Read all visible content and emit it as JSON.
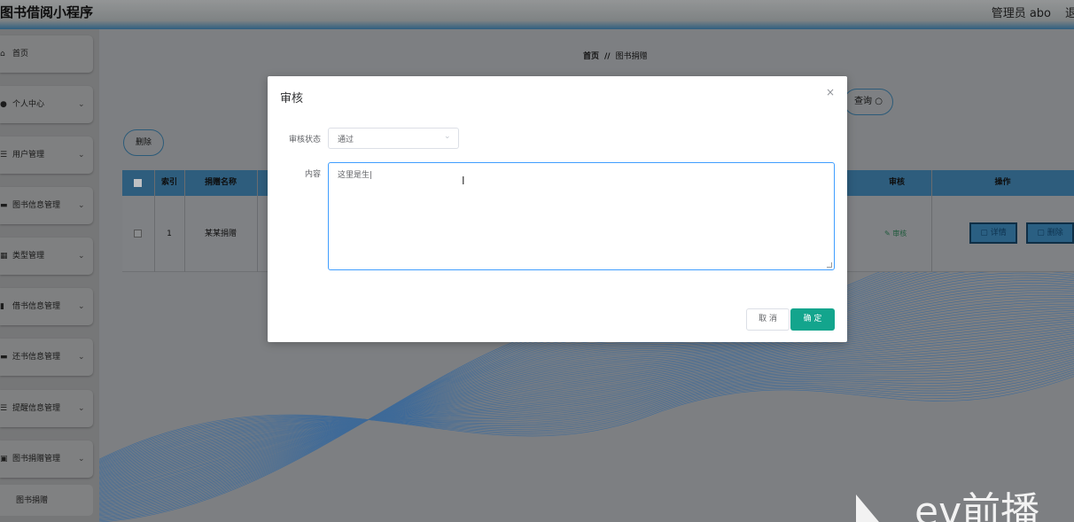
{
  "header": {
    "app_title": "图书借阅小程序",
    "admin_label": "管理员 abo",
    "logout_label": "退"
  },
  "sidebar": {
    "items": [
      {
        "label": "首页",
        "icon": "home-icon",
        "has_chevron": false
      },
      {
        "label": "个人中心",
        "icon": "user-icon",
        "has_chevron": true
      },
      {
        "label": "用户管理",
        "icon": "list-icon",
        "has_chevron": true
      },
      {
        "label": "图书信息管理",
        "icon": "card-icon",
        "has_chevron": true
      },
      {
        "label": "类型管理",
        "icon": "grid-icon",
        "has_chevron": true
      },
      {
        "label": "借书信息管理",
        "icon": "bar-chart-icon",
        "has_chevron": true
      },
      {
        "label": "还书信息管理",
        "icon": "card-icon",
        "has_chevron": true
      },
      {
        "label": "提醒信息管理",
        "icon": "list-icon",
        "has_chevron": true
      },
      {
        "label": "图书捐赠管理",
        "icon": "clipboard-icon",
        "has_chevron": true
      }
    ],
    "sub_item": {
      "label": "图书捐赠"
    }
  },
  "breadcrumb": {
    "home": "首页",
    "separator": "//",
    "current": "图书捐赠"
  },
  "toolbar": {
    "query_label": "查询",
    "delete_label": "删除"
  },
  "table": {
    "columns": {
      "index": "索引",
      "donation_name": "捐赠名称",
      "review": "审核",
      "actions": "操作"
    },
    "rows": [
      {
        "index": "1",
        "donation_name": "某某捐赠",
        "review_link": "审核",
        "detail_label": "详情",
        "delete_label": "删除"
      }
    ]
  },
  "modal": {
    "title": "审核",
    "close": "×",
    "status_label": "审核状态",
    "status_value": "通过",
    "content_label": "内容",
    "content_value": "这里是生|",
    "cancel_label": "取 消",
    "confirm_label": "确 定"
  },
  "colors": {
    "overlay": "#7d7f82",
    "header_accent": "#2f5f80",
    "primary_button": "#13a58d",
    "textarea_focus_border": "#409eff"
  }
}
